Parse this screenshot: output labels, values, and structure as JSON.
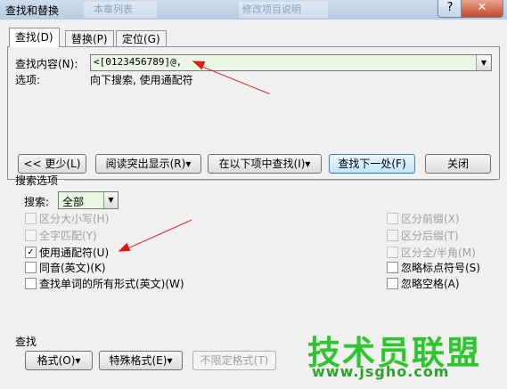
{
  "window": {
    "title": "查找和替换",
    "ghost_tab_1": "  本章列表  ",
    "ghost_tab_2": "修改项目说明",
    "help_label": "?",
    "close_label": "✕"
  },
  "tabs": [
    {
      "label": "查找(D)"
    },
    {
      "label": "替换(P)"
    },
    {
      "label": "定位(G)"
    }
  ],
  "find": {
    "label": "查找内容(N):",
    "value": "<[0123456789]@,",
    "options_label": "选项:",
    "options_value": "向下搜索, 使用通配符"
  },
  "buttons": {
    "less": "<< 更少(L)",
    "reading_highlight": "阅读突出显示(R)▾",
    "find_in": "在以下项中查找(I)▾",
    "find_next": "查找下一处(F)",
    "close": "关闭"
  },
  "search_options": {
    "title": "搜索选项",
    "search_label": "搜索:",
    "search_value": "全部",
    "left_checkboxes": [
      {
        "label": "区分大小写(H)",
        "checked": false,
        "enabled": false
      },
      {
        "label": "全字匹配(Y)",
        "checked": false,
        "enabled": false
      },
      {
        "label": "使用通配符(U)",
        "checked": true,
        "enabled": true
      },
      {
        "label": "同音(英文)(K)",
        "checked": false,
        "enabled": true
      },
      {
        "label": "查找单词的所有形式(英文)(W)",
        "checked": false,
        "enabled": true
      }
    ],
    "right_checkboxes": [
      {
        "label": "区分前缀(X)",
        "checked": false,
        "enabled": false
      },
      {
        "label": "区分后缀(T)",
        "checked": false,
        "enabled": false
      },
      {
        "label": "区分全/半角(M)",
        "checked": false,
        "enabled": false
      },
      {
        "label": "忽略标点符号(S)",
        "checked": false,
        "enabled": true
      },
      {
        "label": "忽略空格(A)",
        "checked": false,
        "enabled": true
      }
    ]
  },
  "find_section": {
    "title": "查找",
    "format_button": "格式(O)▾",
    "special_button": "特殊格式(E)▾",
    "no_format_button": "不限定格式(T)"
  },
  "watermark": {
    "text": "技术员联盟",
    "url": "www.jsgho.com"
  },
  "colors": {
    "annotation_arrow": "#e01818",
    "field_bg": "#e9f6e4",
    "watermark": "#2ec52e"
  }
}
